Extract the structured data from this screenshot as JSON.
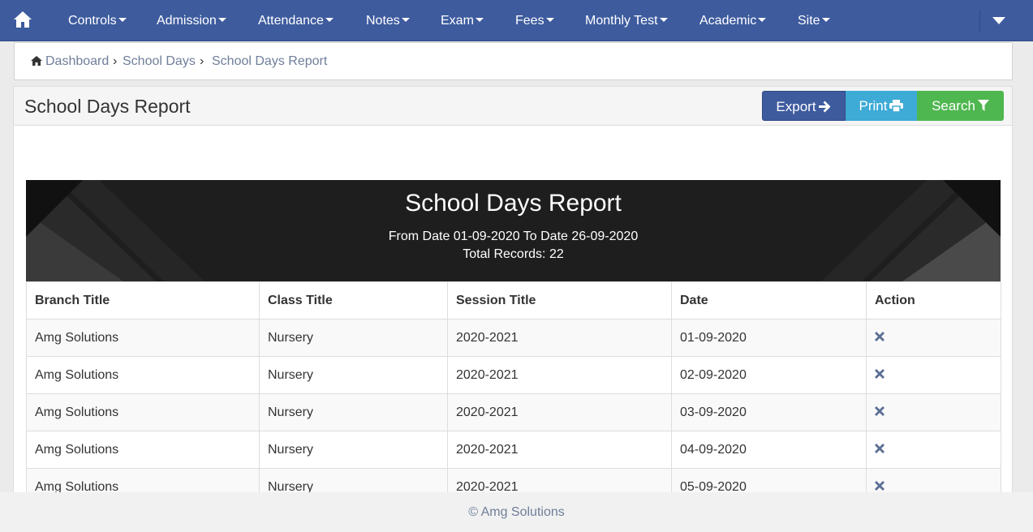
{
  "nav": {
    "home_icon": "home-icon",
    "items": [
      {
        "label": "Controls"
      },
      {
        "label": "Admission"
      },
      {
        "label": "Attendance"
      },
      {
        "label": "Notes"
      },
      {
        "label": "Exam"
      },
      {
        "label": "Fees"
      },
      {
        "label": "Monthly Test"
      },
      {
        "label": "Academic"
      },
      {
        "label": "Site"
      }
    ],
    "toggle_icon": "caret-down-icon"
  },
  "breadcrumb": {
    "home": "Dashboard",
    "section": "School Days",
    "current": "School Days Report"
  },
  "panel": {
    "title": "School Days Report",
    "buttons": {
      "export": "Export",
      "print": "Print",
      "search": "Search"
    }
  },
  "report": {
    "title": "School Days Report",
    "range": "From Date 01-09-2020 To Date 26-09-2020",
    "total": "Total Records: 22",
    "columns": [
      "Branch Title",
      "Class Title",
      "Session Title",
      "Date",
      "Action"
    ],
    "rows": [
      {
        "branch": "Amg Solutions",
        "class": "Nursery",
        "session": "2020-2021",
        "date": "01-09-2020"
      },
      {
        "branch": "Amg Solutions",
        "class": "Nursery",
        "session": "2020-2021",
        "date": "02-09-2020"
      },
      {
        "branch": "Amg Solutions",
        "class": "Nursery",
        "session": "2020-2021",
        "date": "03-09-2020"
      },
      {
        "branch": "Amg Solutions",
        "class": "Nursery",
        "session": "2020-2021",
        "date": "04-09-2020"
      },
      {
        "branch": "Amg Solutions",
        "class": "Nursery",
        "session": "2020-2021",
        "date": "05-09-2020"
      }
    ]
  },
  "footer": {
    "text": "© Amg Solutions"
  },
  "colors": {
    "navbar": "#3e5b9e",
    "export": "#3e5b9e",
    "print": "#3eaad6",
    "search": "#4fb74f",
    "link": "#6f7e9a"
  }
}
